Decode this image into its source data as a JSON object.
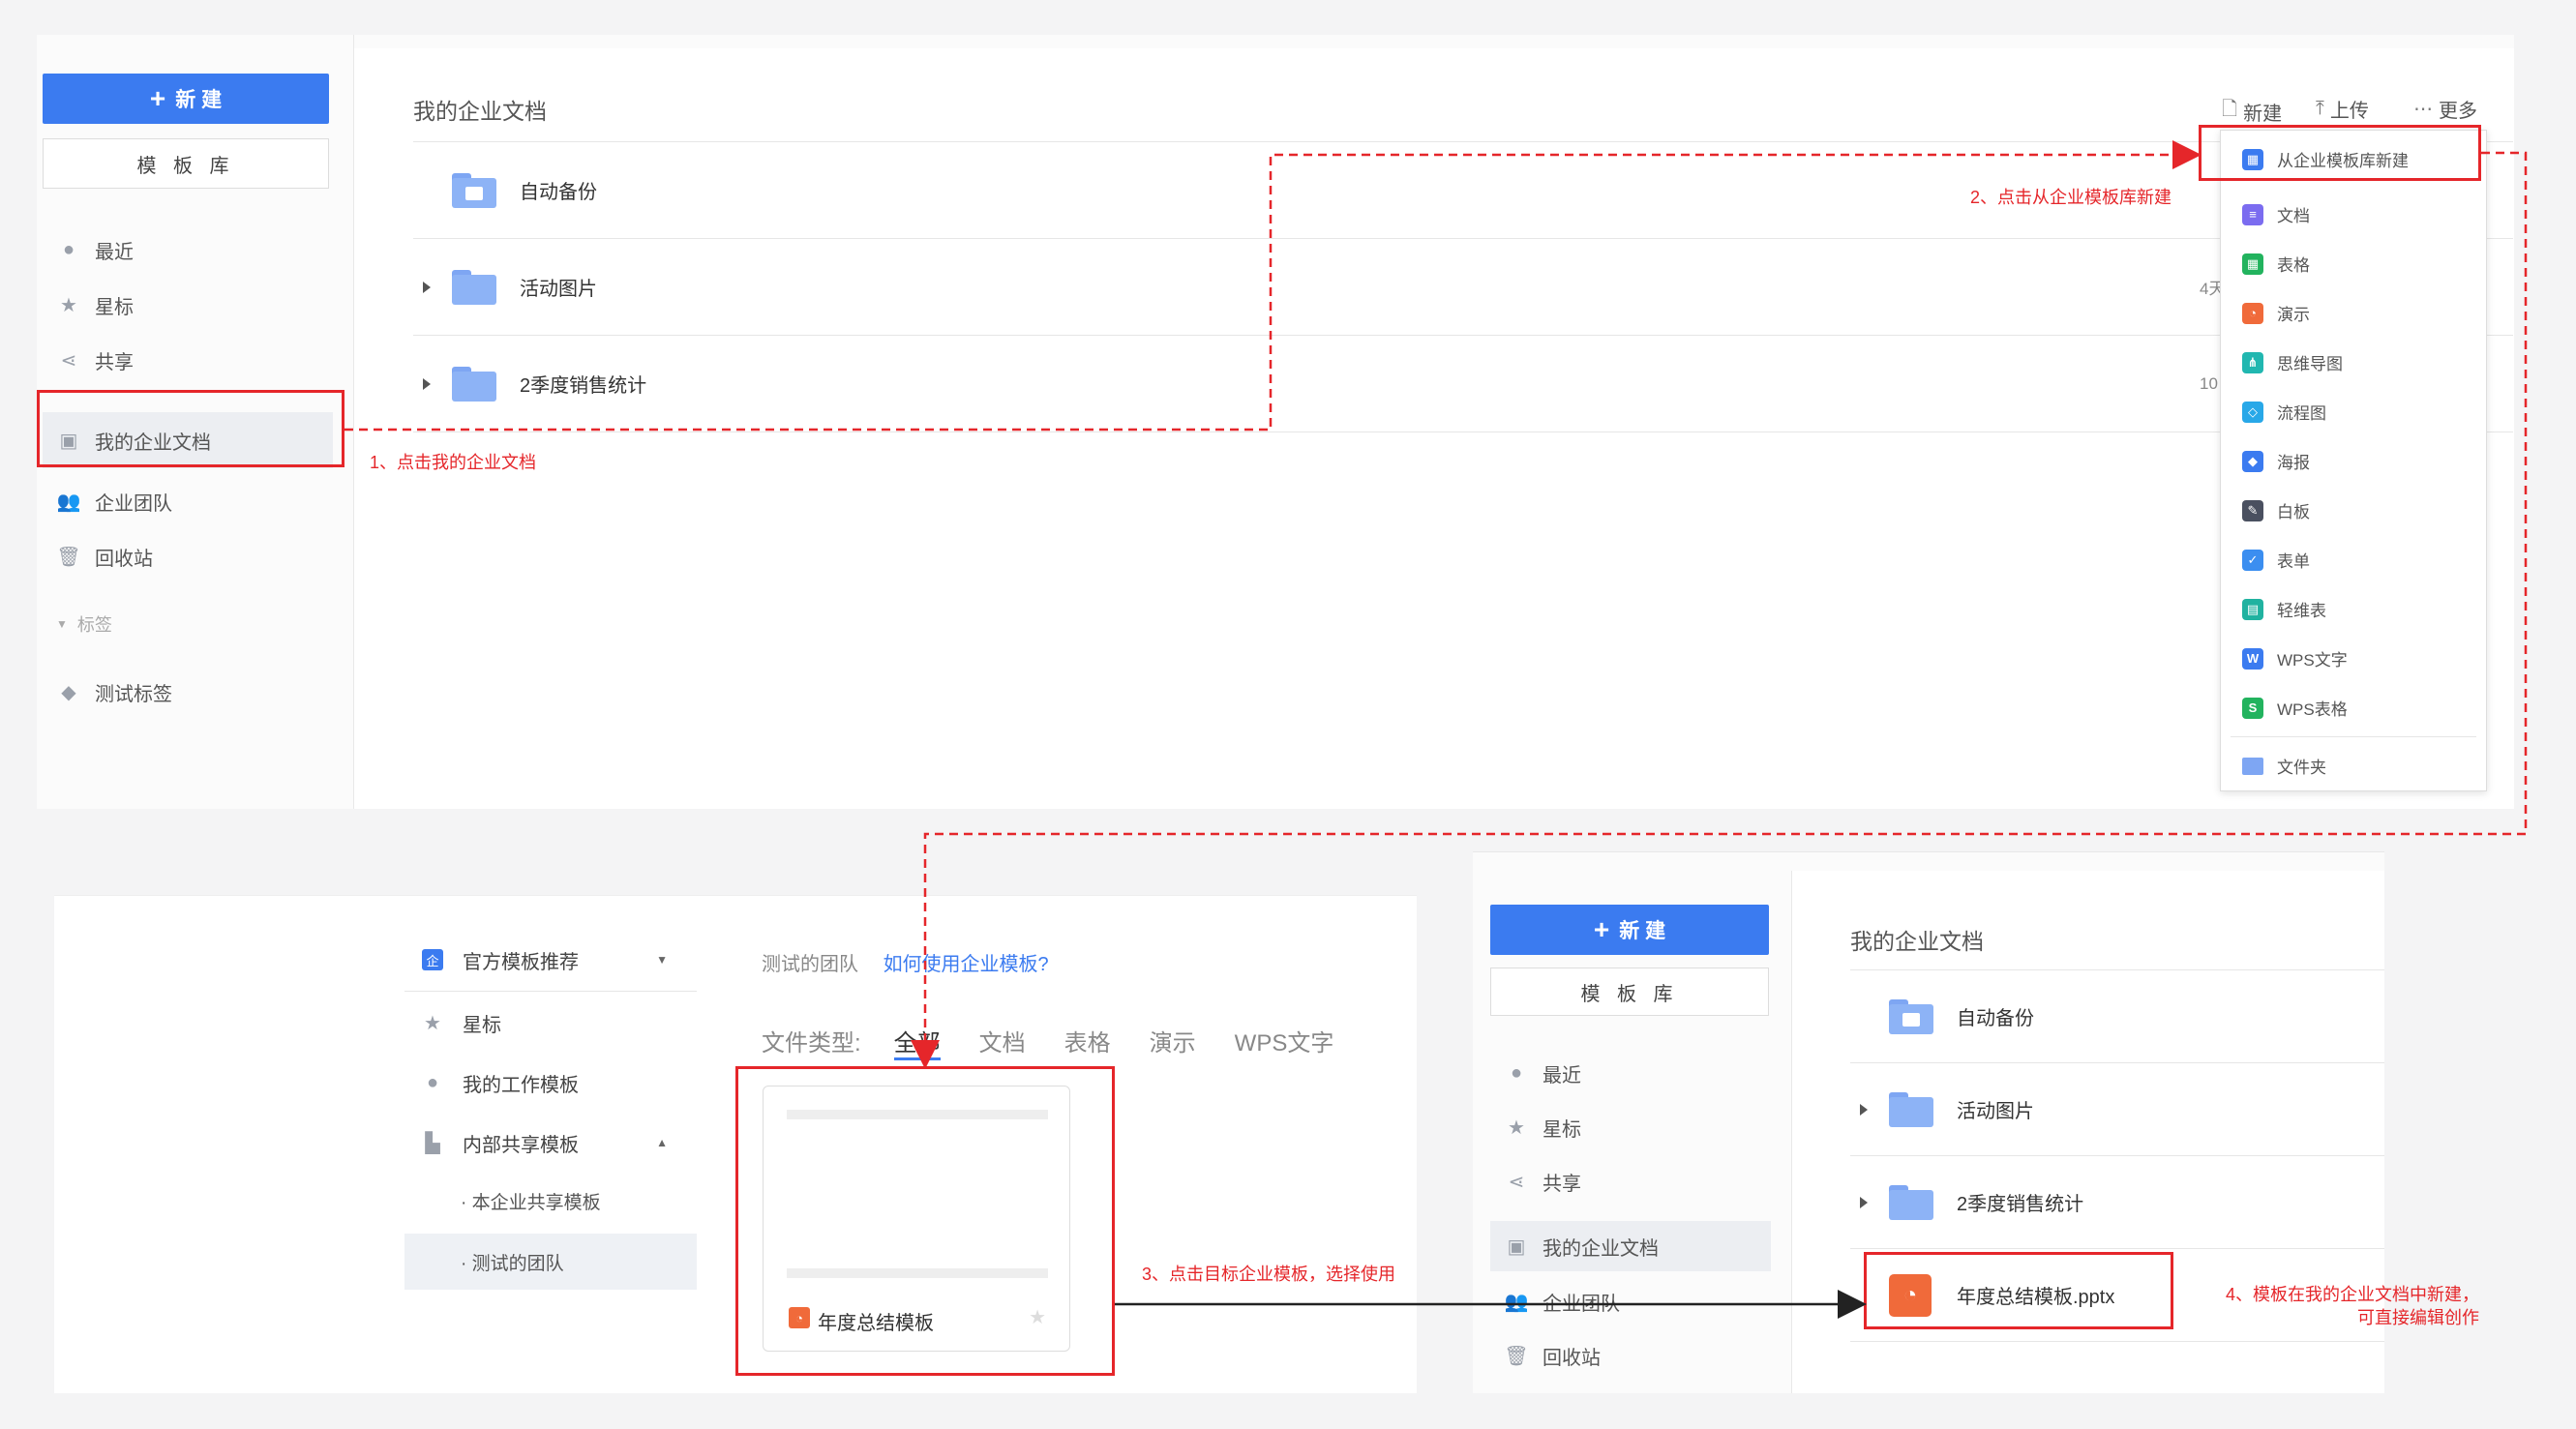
{
  "top": {
    "sidebar": {
      "new_label": "新 建",
      "template_label": "模 板 库",
      "items": [
        {
          "label": "最近",
          "icon": "clock-icon"
        },
        {
          "label": "星标",
          "icon": "star-icon"
        },
        {
          "label": "共享",
          "icon": "share-icon"
        },
        {
          "label": "我的企业文档",
          "icon": "enterprise-doc-icon"
        },
        {
          "label": "企业团队",
          "icon": "team-icon"
        },
        {
          "label": "回收站",
          "icon": "trash-icon"
        }
      ],
      "tags_header": "标签",
      "tags": [
        {
          "label": "测试标签"
        }
      ]
    },
    "breadcrumb": "我的企业文档",
    "toolbar": {
      "new": "新建",
      "upload": "上传",
      "more": "更多"
    },
    "files": [
      {
        "name": "自动备份",
        "meta": ""
      },
      {
        "name": "活动图片",
        "meta": "4天"
      },
      {
        "name": "2季度销售统计",
        "meta": "10"
      }
    ],
    "dropdown": {
      "items": [
        {
          "label": "从企业模板库新建",
          "color": "#3b7bf0",
          "glyph": "▦"
        },
        {
          "label": "文档",
          "color": "#7b6cf0",
          "glyph": "≡"
        },
        {
          "label": "表格",
          "color": "#22b35e",
          "glyph": "▦"
        },
        {
          "label": "演示",
          "color": "#f06a3a",
          "glyph": "◔"
        },
        {
          "label": "思维导图",
          "color": "#21b7b0",
          "glyph": "⋔"
        },
        {
          "label": "流程图",
          "color": "#28a8e8",
          "glyph": "◇"
        },
        {
          "label": "海报",
          "color": "#3b7bf0",
          "glyph": "◆"
        },
        {
          "label": "白板",
          "color": "#4a5060",
          "glyph": "✎"
        },
        {
          "label": "表单",
          "color": "#3b8ef0",
          "glyph": "✓"
        },
        {
          "label": "轻维表",
          "color": "#20b2a0",
          "glyph": "▤"
        },
        {
          "label": "WPS文字",
          "color": "#3b7bf0",
          "glyph": "W"
        },
        {
          "label": "WPS表格",
          "color": "#22b35e",
          "glyph": "S"
        },
        {
          "label": "文件夹",
          "color": "#7ea6f3",
          "glyph": ""
        }
      ]
    }
  },
  "annotations": {
    "step1": "1、点击我的企业文档",
    "step2": "2、点击从企业模板库新建",
    "step3": "3、点击目标企业模板，选择使用",
    "step4_line1": "4、模板在我的企业文档中新建，",
    "step4_line2": "可直接编辑创作"
  },
  "template_lib": {
    "nav": [
      {
        "label": "官方模板推荐",
        "icon": "enterprise-icon"
      },
      {
        "label": "星标",
        "icon": "star-icon"
      },
      {
        "label": "我的工作模板",
        "icon": "user-icon"
      },
      {
        "label": "内部共享模板",
        "icon": "building-icon"
      }
    ],
    "sub_nav": [
      "· 本企业共享模板",
      "· 测试的团队"
    ],
    "team_name": "测试的团队",
    "help_link": "如何使用企业模板?",
    "file_type_label": "文件类型:",
    "file_types": [
      "全部",
      "文档",
      "表格",
      "演示",
      "WPS文字"
    ],
    "card_name": "年度总结模板"
  },
  "result": {
    "sidebar": {
      "new_label": "新 建",
      "template_label": "模 板 库",
      "items": [
        {
          "label": "最近"
        },
        {
          "label": "星标"
        },
        {
          "label": "共享"
        },
        {
          "label": "我的企业文档"
        },
        {
          "label": "企业团队"
        },
        {
          "label": "回收站"
        }
      ]
    },
    "breadcrumb": "我的企业文档",
    "files": [
      {
        "name": "自动备份"
      },
      {
        "name": "活动图片"
      },
      {
        "name": "2季度销售统计"
      },
      {
        "name": "年度总结模板.pptx"
      }
    ]
  }
}
